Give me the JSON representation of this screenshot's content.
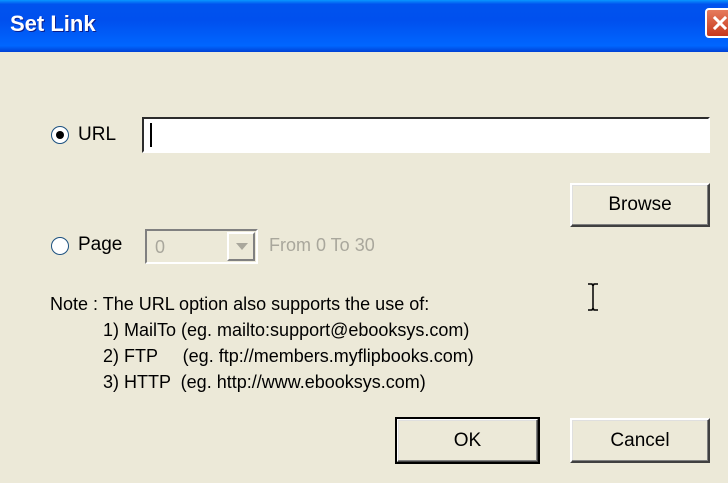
{
  "window": {
    "title": "Set Link",
    "close_icon": "close-icon"
  },
  "url_option": {
    "label": "URL",
    "selected": true,
    "value": ""
  },
  "browse_button": {
    "label": "Browse"
  },
  "page_option": {
    "label": "Page",
    "selected": false,
    "combo_value": "0",
    "range_text": "From 0 To 30"
  },
  "note": {
    "heading": "Note : The URL option also supports the use of:",
    "lines": [
      "1) MailTo (eg. mailto:support@ebooksys.com)",
      "2) FTP     (eg. ftp://members.myflipbooks.com)",
      "3) HTTP  (eg. http://www.ebooksys.com)"
    ]
  },
  "buttons": {
    "ok": "OK",
    "cancel": "Cancel"
  },
  "colors": {
    "titlebar": "#0054e3",
    "close": "#d54a2a",
    "dialog_bg": "#ece9d8",
    "disabled_text": "#a9a79c"
  }
}
